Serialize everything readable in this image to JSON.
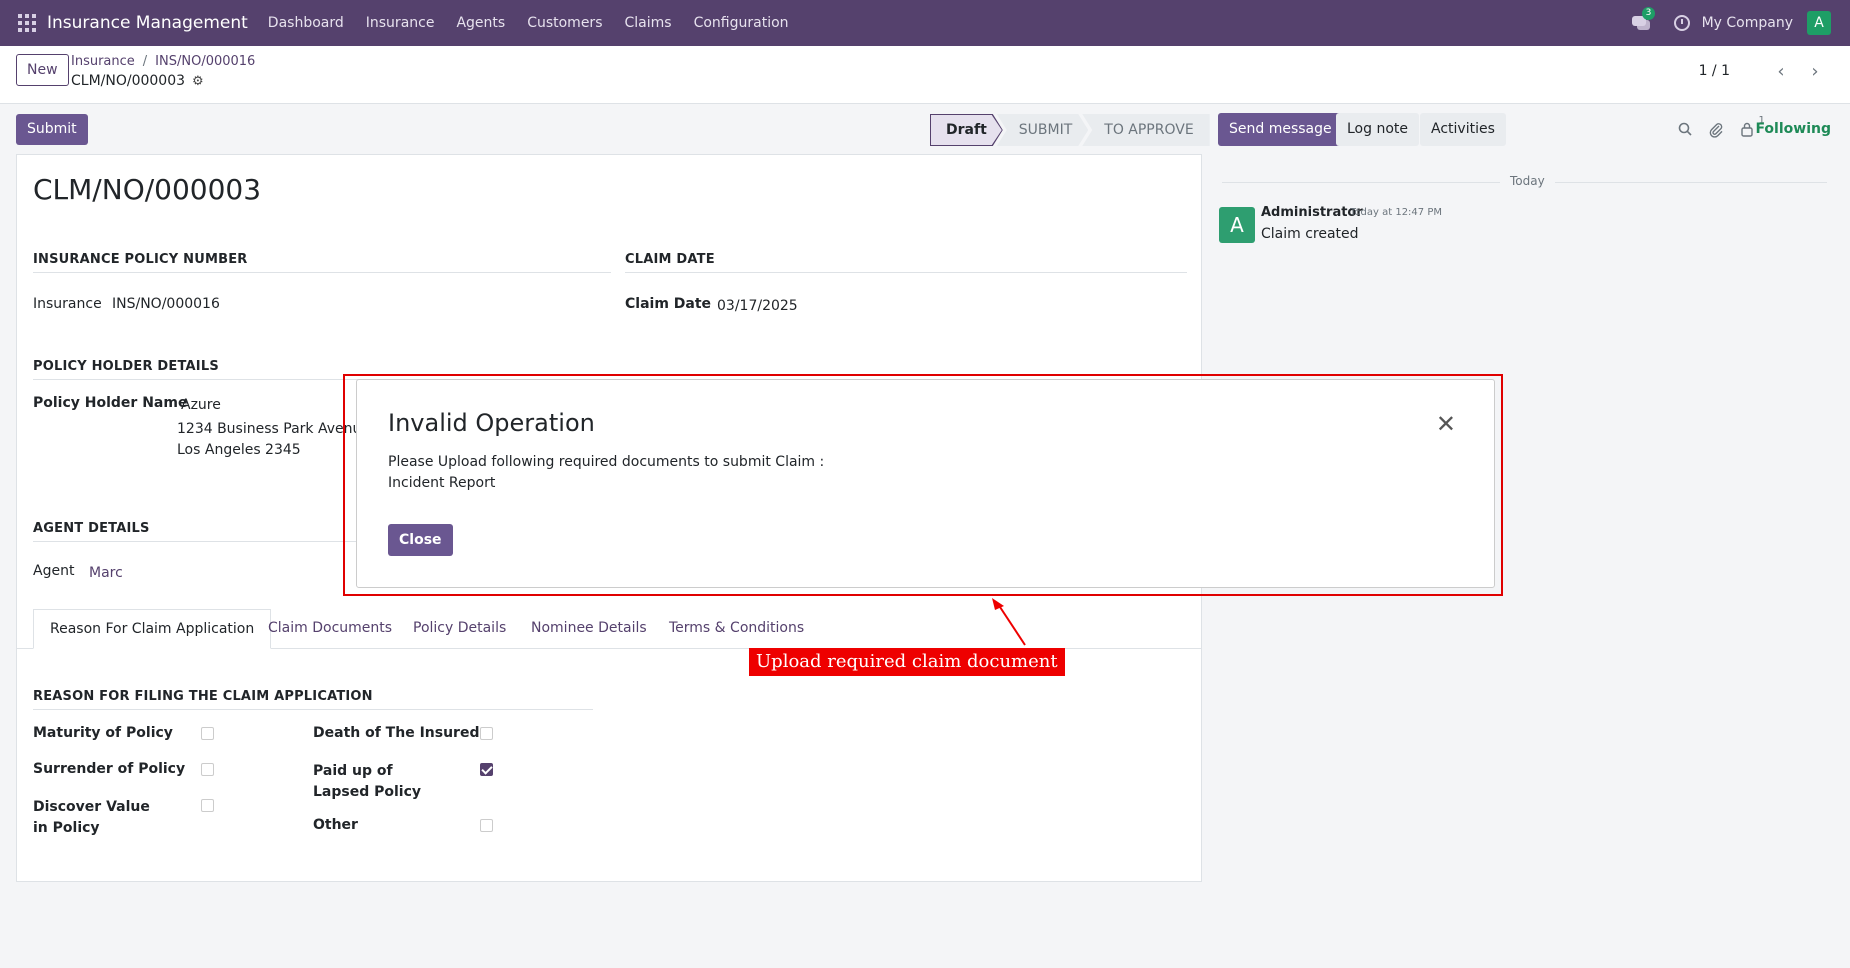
{
  "navbar": {
    "app_title": "Insurance Management",
    "menu": [
      "Dashboard",
      "Insurance",
      "Agents",
      "Customers",
      "Claims",
      "Configuration"
    ],
    "chat_badge": "3",
    "company": "My Company",
    "avatar_letter": "A"
  },
  "control_panel": {
    "new_label": "New",
    "breadcrumb": [
      "Insurance",
      "INS/NO/000016"
    ],
    "record_name": "CLM/NO/000003",
    "pager": "1 / 1"
  },
  "actions": {
    "submit_label": "Submit",
    "stages": [
      "Draft",
      "SUBMIT",
      "TO APPROVE"
    ]
  },
  "form": {
    "title": "CLM/NO/000003",
    "policy_section": "INSURANCE POLICY NUMBER",
    "insurance_label": "Insurance",
    "insurance_value": "INS/NO/000016",
    "claim_date_section": "CLAIM DATE",
    "claim_date_label": "Claim Date",
    "claim_date_value": "03/17/2025",
    "holder_section": "POLICY HOLDER DETAILS",
    "holder_name_label": "Policy Holder Name",
    "holder_name_value": "Azure",
    "holder_address_1": "1234 Business Park Avenue,",
    "holder_address_2": "Los Angeles 2345",
    "agent_section": "AGENT DETAILS",
    "agent_label": "Agent",
    "agent_value": "Marc",
    "tabs": [
      "Reason For Claim Application",
      "Claim Documents",
      "Policy Details",
      "Nominee Details",
      "Terms & Conditions"
    ],
    "reason_section": "REASON FOR FILING THE CLAIM APPLICATION",
    "reasons": [
      {
        "label": "Maturity of Policy",
        "checked": false
      },
      {
        "label": "Surrender of Policy",
        "checked": false
      },
      {
        "label": "Discover Value in Policy",
        "checked": false
      },
      {
        "label": "Death of The Insured",
        "checked": false
      },
      {
        "label": "Paid up of Lapsed Policy",
        "checked": true
      },
      {
        "label": "Other",
        "checked": false
      }
    ]
  },
  "chatter": {
    "send_message": "Send message",
    "log_note": "Log note",
    "activities": "Activities",
    "followers_count": "1",
    "following": "Following",
    "today": "Today",
    "message": {
      "author": "Administrator",
      "time": "Today at 12:47 PM",
      "body": "Claim created",
      "avatar_letter": "A"
    }
  },
  "modal": {
    "title": "Invalid Operation",
    "line1": "Please Upload following required documents to submit Claim :",
    "line2": "Incident Report",
    "close_label": "Close"
  },
  "annotation": {
    "text": "Upload required claim document"
  }
}
